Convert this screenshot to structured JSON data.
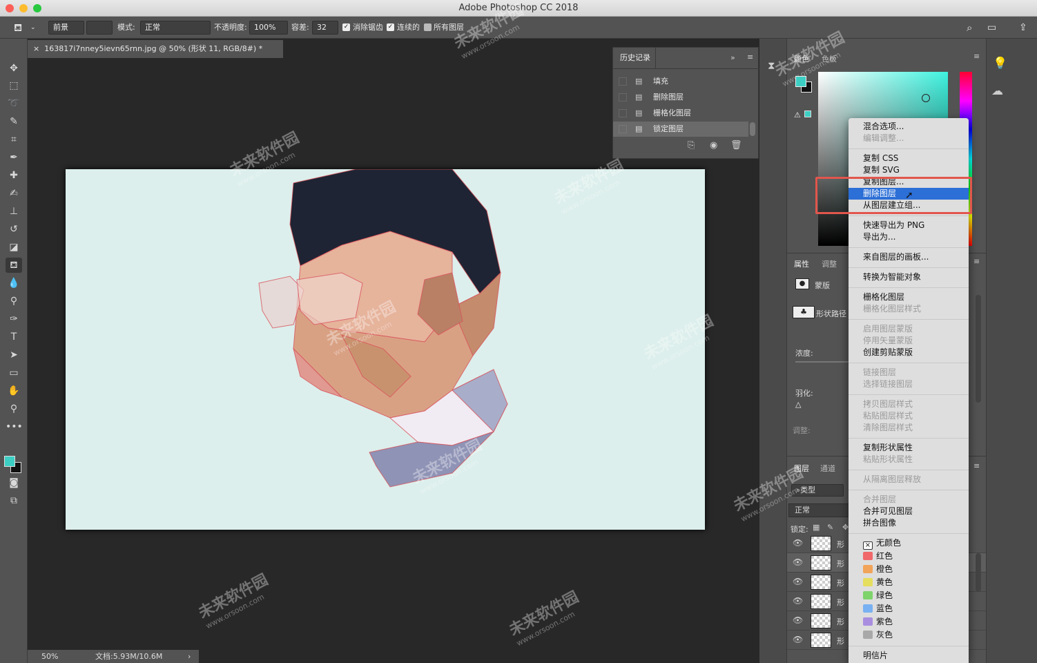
{
  "window": {
    "title": "Adobe Photoshop CC 2018"
  },
  "options_bar": {
    "fill_source": "前景",
    "mode_label": "模式:",
    "mode_value": "正常",
    "opacity_label": "不透明度:",
    "opacity_value": "100%",
    "tolerance_label": "容差:",
    "tolerance_value": "32",
    "anti_alias_label": "消除锯齿",
    "contiguous_label": "连续的",
    "all_layers_label": "所有图层"
  },
  "document": {
    "tab_title": "163817i7nney5ievn65rnn.jpg @ 50% (形状 11, RGB/8#) *",
    "zoom": "50%",
    "doc_size": "文档:5.93M/10.6M"
  },
  "history": {
    "tab": "历史记录",
    "items": [
      "填充",
      "删除图层",
      "栅格化图层",
      "锁定图层"
    ]
  },
  "color_panel": {
    "tab1": "颜色",
    "tab2": "色板"
  },
  "properties": {
    "tab1": "属性",
    "tab2": "调整",
    "mask": "蒙版",
    "shape_path": "形状路径",
    "density": "浓度:",
    "feather": "羽化:",
    "adjust": "调整:"
  },
  "layers": {
    "tab1": "图层",
    "tab2": "通道",
    "filter": "类型",
    "blend": "正常",
    "lock": "锁定:",
    "row_label": "形"
  },
  "context_menu": {
    "items": [
      {
        "label": "混合选项...",
        "disabled": false
      },
      {
        "label": "编辑调整...",
        "disabled": true
      },
      {
        "label": "复制 CSS",
        "disabled": false
      },
      {
        "label": "复制 SVG",
        "disabled": false
      },
      {
        "label": "复制图层...",
        "disabled": false
      },
      {
        "label": "删除图层",
        "disabled": false,
        "highlighted": true
      },
      {
        "label": "从图层建立组...",
        "disabled": false
      },
      {
        "label": "快速导出为 PNG",
        "disabled": false
      },
      {
        "label": "导出为...",
        "disabled": false
      },
      {
        "label": "来自图层的画板...",
        "disabled": false
      },
      {
        "label": "转换为智能对象",
        "disabled": false
      },
      {
        "label": "栅格化图层",
        "disabled": false
      },
      {
        "label": "栅格化图层样式",
        "disabled": true
      },
      {
        "label": "启用图层蒙版",
        "disabled": true
      },
      {
        "label": "停用矢量蒙版",
        "disabled": true
      },
      {
        "label": "创建剪贴蒙版",
        "disabled": false
      },
      {
        "label": "链接图层",
        "disabled": true
      },
      {
        "label": "选择链接图层",
        "disabled": true
      },
      {
        "label": "拷贝图层样式",
        "disabled": true
      },
      {
        "label": "粘贴图层样式",
        "disabled": true
      },
      {
        "label": "清除图层样式",
        "disabled": true
      },
      {
        "label": "复制形状属性",
        "disabled": false
      },
      {
        "label": "粘贴形状属性",
        "disabled": true
      },
      {
        "label": "从隔离图层释放",
        "disabled": true
      },
      {
        "label": "合并图层",
        "disabled": true
      },
      {
        "label": "合并可见图层",
        "disabled": false
      },
      {
        "label": "拼合图像",
        "disabled": false
      }
    ],
    "colors": [
      {
        "label": "无颜色",
        "color": "none"
      },
      {
        "label": "红色",
        "color": "#f0686a"
      },
      {
        "label": "橙色",
        "color": "#f2a45a"
      },
      {
        "label": "黄色",
        "color": "#e6de5e"
      },
      {
        "label": "绿色",
        "color": "#7ed36b"
      },
      {
        "label": "蓝色",
        "color": "#79b1f2"
      },
      {
        "label": "紫色",
        "color": "#a98ee0"
      },
      {
        "label": "灰色",
        "color": "#a8a8a8"
      }
    ],
    "postcard": "明信片"
  },
  "watermark": {
    "brand": "未来软件园",
    "url": "www.orsoon.com"
  },
  "colors": {
    "foreground": "#3ecfc4",
    "background": "#111111",
    "highlight": "#2c6fd6",
    "annotation": "#e2564d"
  }
}
